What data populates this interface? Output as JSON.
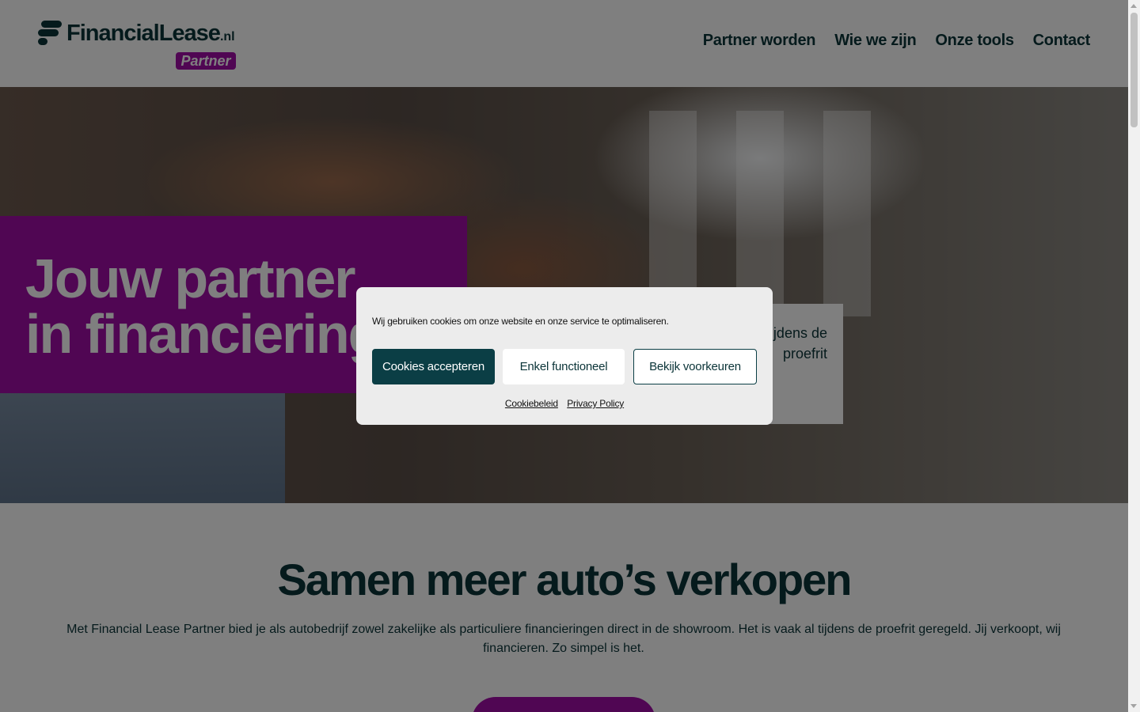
{
  "header": {
    "logo": {
      "wordmark": "FinancialLease",
      "tld": ".nl",
      "badge": "Partner",
      "icon": "financiallease-logo-icon"
    },
    "nav": [
      {
        "label": "Partner worden"
      },
      {
        "label": "Wie we zijn"
      },
      {
        "label": "Onze tools"
      },
      {
        "label": "Contact"
      }
    ]
  },
  "hero": {
    "title_line1": "Jouw partner",
    "title_line2": "in financiering",
    "text": "Jij verkoopt, wij financieren. Vaak al geregeld tijdens de proefrit"
  },
  "section": {
    "title": "Samen meer auto’s verkopen",
    "body": "Met Financial Lease Partner bied je als autobedrijf zowel zakelijke als particuliere financieringen direct in de showroom. Het is vaak al tijdens de proefrit geregeld. Jij verkoopt, wij financieren. Zo simpel is het."
  },
  "cookie": {
    "message": "Wij gebruiken cookies om onze website en onze service te optimaliseren.",
    "accept_label": "Cookies accepteren",
    "functional_label": "Enkel functioneel",
    "preferences_label": "Bekijk voorkeuren",
    "links": [
      {
        "label": "Cookiebeleid"
      },
      {
        "label": "Privacy Policy"
      }
    ]
  },
  "colors": {
    "brand_magenta": "#a10da6",
    "brand_dark_teal": "#0b3438",
    "button_teal": "#0b3e45"
  }
}
